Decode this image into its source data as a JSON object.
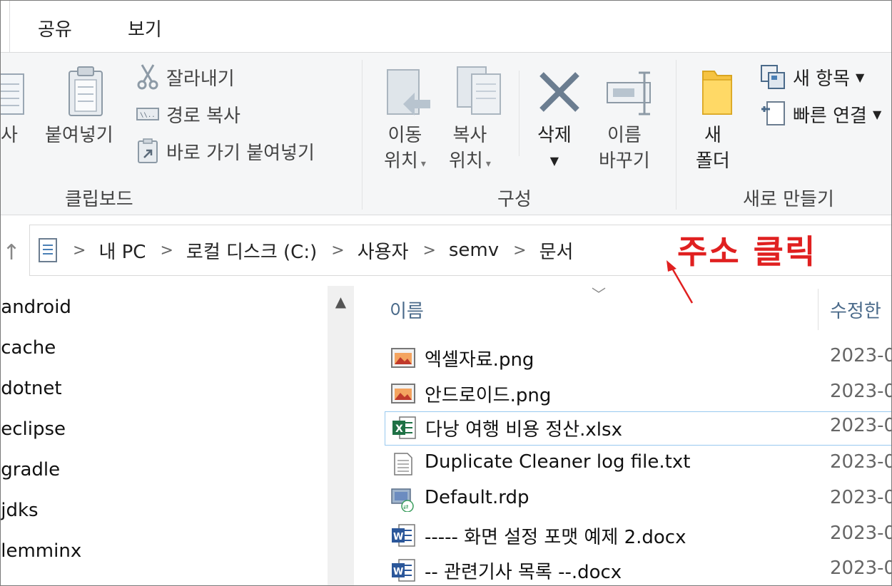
{
  "tabs": [
    {
      "label": "공유"
    },
    {
      "label": "보기"
    }
  ],
  "ribbon": {
    "clipboard": {
      "copy_label": "사",
      "paste_label": "붙여넣기",
      "cut_label": "잘라내기",
      "copy_path_label": "경로 복사",
      "paste_shortcut_label": "바로 가기 붙여넣기",
      "group_label": "클립보드"
    },
    "organize": {
      "move_to_line1": "이동",
      "move_to_line2": "위치",
      "copy_to_line1": "복사",
      "copy_to_line2": "위치",
      "delete_label": "삭제",
      "rename_line1": "이름",
      "rename_line2": "바꾸기",
      "group_label": "구성"
    },
    "new": {
      "new_folder_line1": "새",
      "new_folder_line2": "폴더",
      "new_item_label": "새 항목",
      "easy_access_label": "빠른 연결",
      "group_label": "새로 만들기"
    }
  },
  "address": {
    "crumbs": [
      "내 PC",
      "로컬 디스크 (C:)",
      "사용자",
      "semv",
      "문서"
    ]
  },
  "annotation": {
    "text": "주소 클릭",
    "color": "#e02020"
  },
  "tree": {
    "items": [
      ".android",
      ".cache",
      ".dotnet",
      ".eclipse",
      ".gradle",
      ".jdks",
      ".lemminx"
    ]
  },
  "files": {
    "header_name": "이름",
    "header_date": "수정한",
    "rows": [
      {
        "name": "엑셀자료.png",
        "date": "2023-0",
        "icon": "image-file-icon"
      },
      {
        "name": "안드로이드.png",
        "date": "2023-0",
        "icon": "image-file-icon"
      },
      {
        "name": "다낭 여행 비용 정산.xlsx",
        "date": "2023-0",
        "icon": "excel-file-icon",
        "selected": true
      },
      {
        "name": "Duplicate Cleaner log file.txt",
        "date": "2023-0",
        "icon": "text-file-icon"
      },
      {
        "name": "Default.rdp",
        "date": "2023-0",
        "icon": "rdp-file-icon"
      },
      {
        "name": "----- 화면 설정 포맷 예제 2.docx",
        "date": "2023-0",
        "icon": "word-file-icon"
      },
      {
        "name": "-- 관련기사 목록 --.docx",
        "date": "2023-0",
        "icon": "word-file-icon"
      }
    ]
  }
}
